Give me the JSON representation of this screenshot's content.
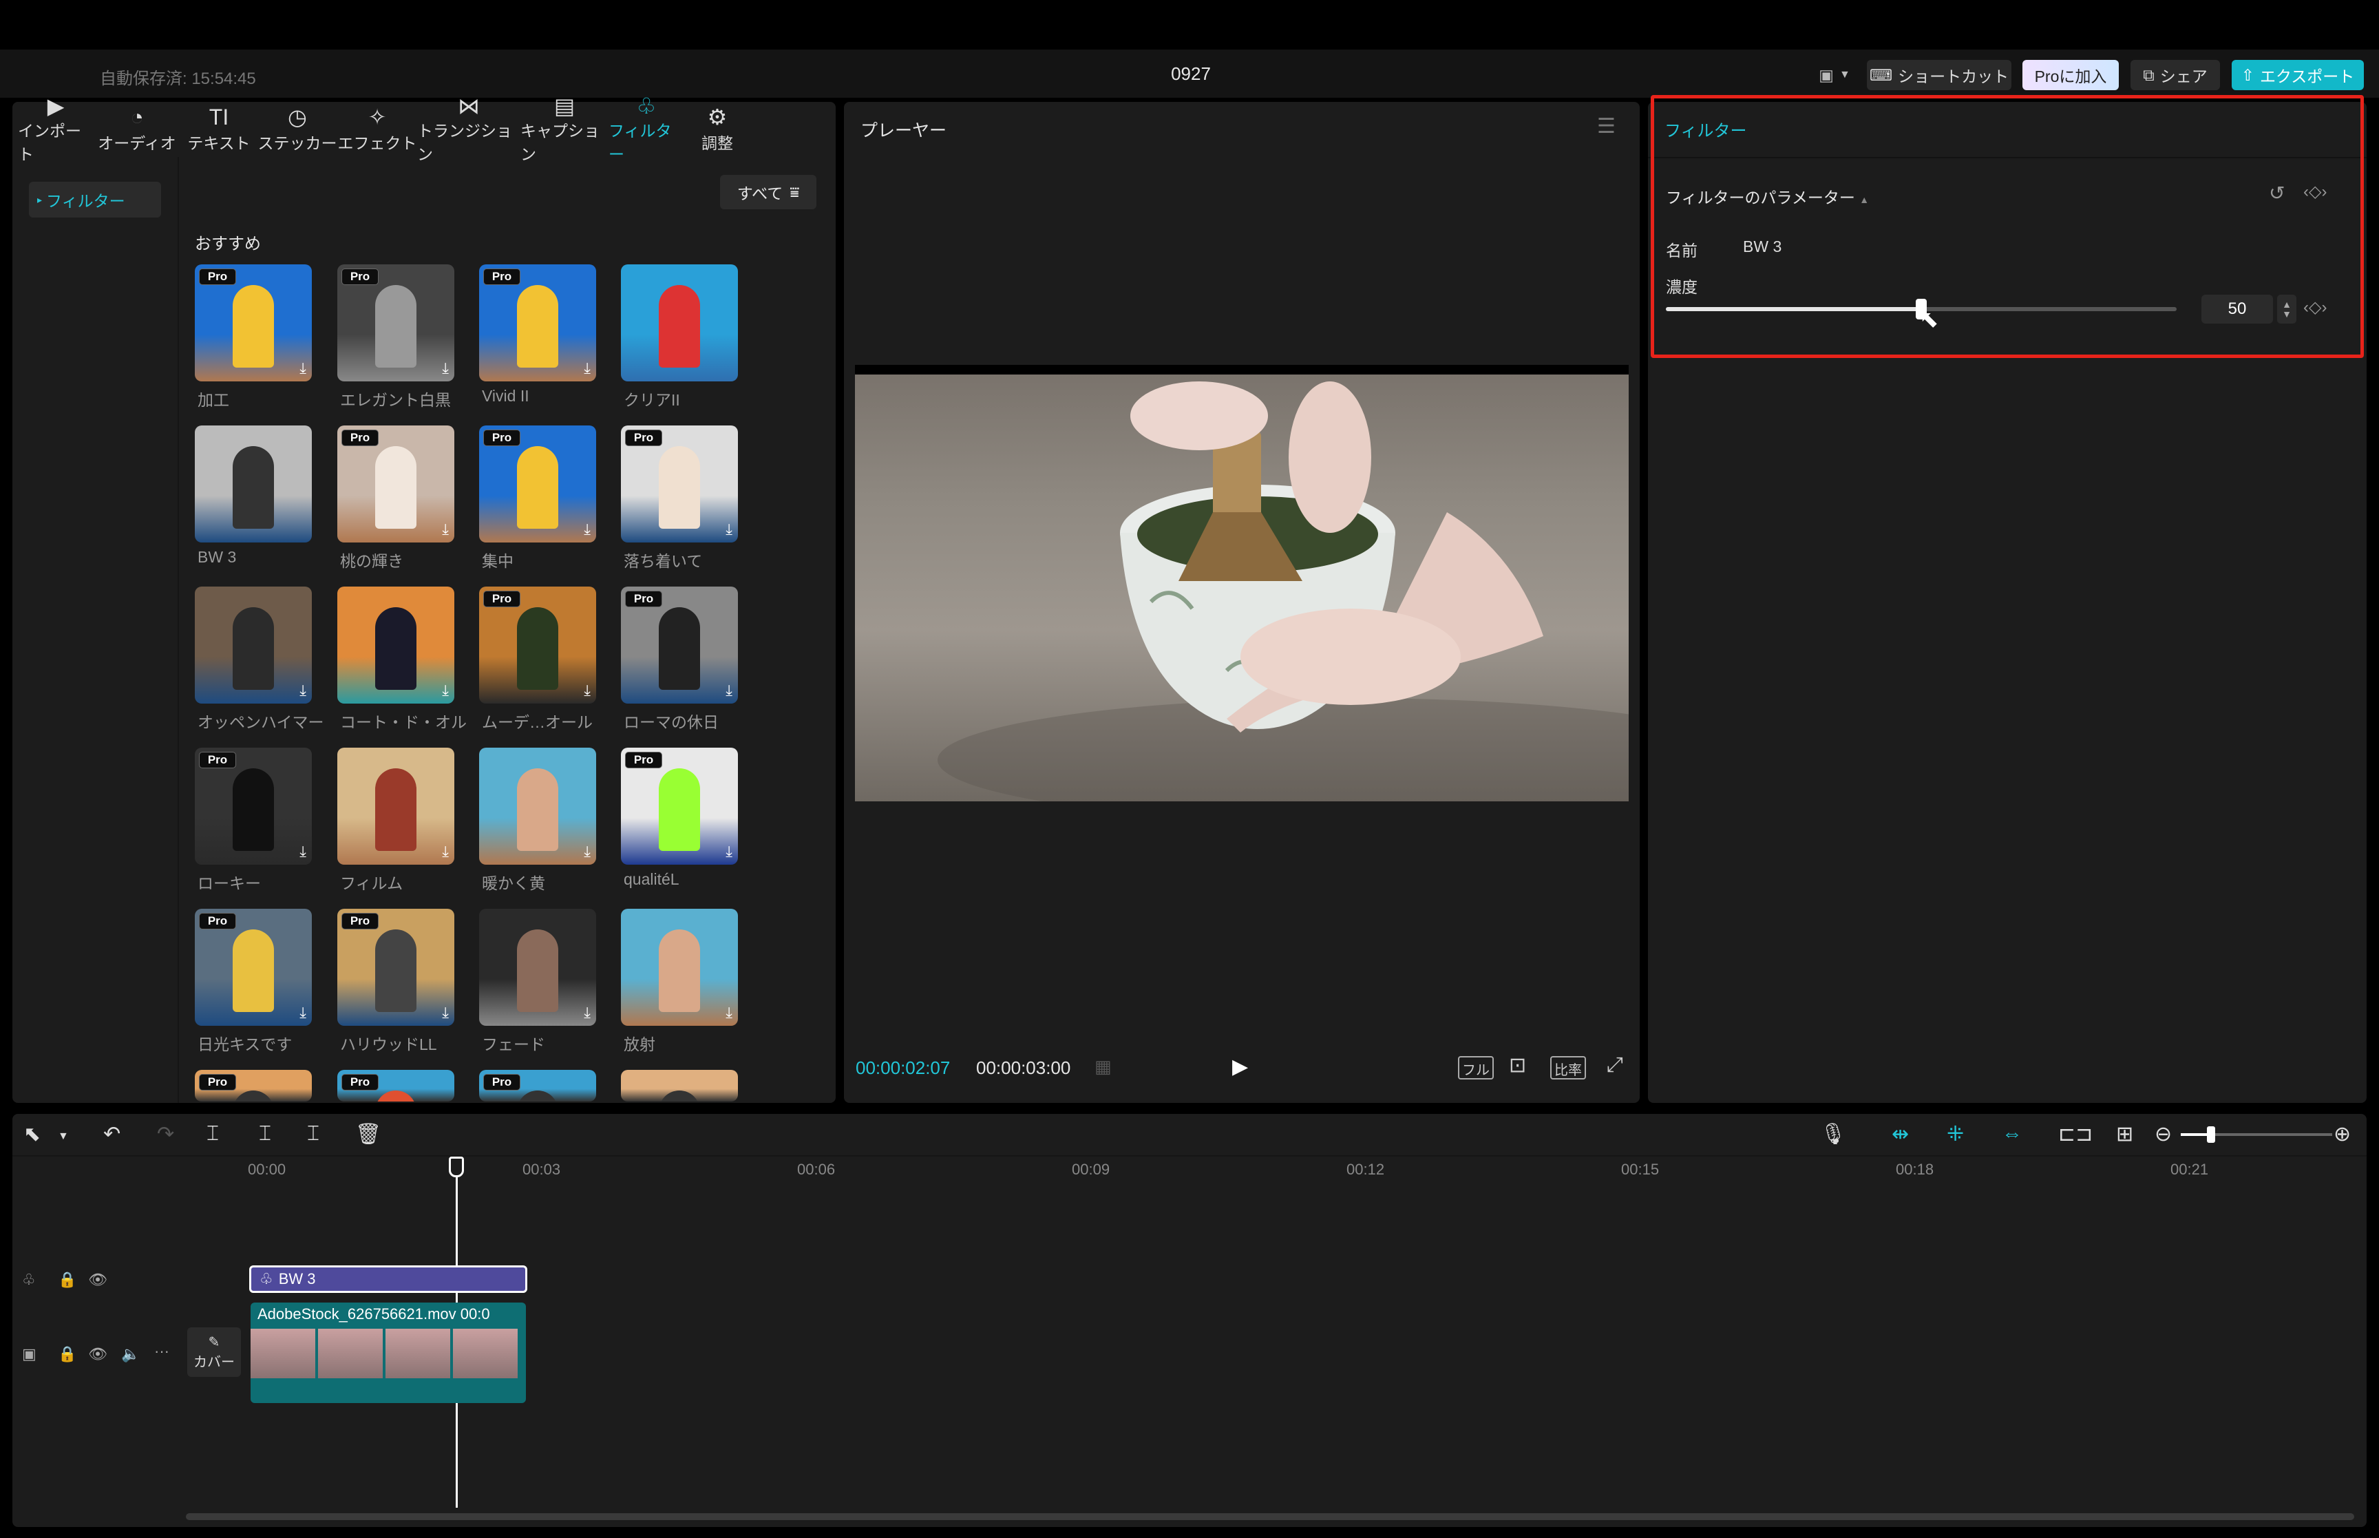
{
  "header": {
    "autosave": "自動保存済: 15:54:45",
    "project_title": "0927",
    "layout_icon": "layout-icon",
    "shortcut_label": "ショートカット",
    "pro_label": "Proに加入",
    "share_label": "シェア",
    "export_label": "エクスポート",
    "accent_color": "#12b8c9"
  },
  "tabs": [
    {
      "label": "インポート",
      "icon": "import-icon"
    },
    {
      "label": "オーディオ",
      "icon": "audio-icon"
    },
    {
      "label": "テキスト",
      "icon": "text-icon"
    },
    {
      "label": "ステッカー",
      "icon": "sticker-icon"
    },
    {
      "label": "エフェクト",
      "icon": "effect-icon"
    },
    {
      "label": "トランジション",
      "icon": "transition-icon"
    },
    {
      "label": "キャプション",
      "icon": "caption-icon"
    },
    {
      "label": "フィルター",
      "icon": "filter-icon",
      "active": true
    },
    {
      "label": "調整",
      "icon": "adjust-icon"
    }
  ],
  "sidebar": {
    "active_item": "フィルター"
  },
  "library": {
    "all_label": "すべて",
    "section_title": "おすすめ",
    "filters": [
      {
        "label": "加工",
        "pro": true
      },
      {
        "label": "エレガント白黒",
        "pro": true
      },
      {
        "label": "Vivid II",
        "pro": true
      },
      {
        "label": "クリアII",
        "pro": false
      },
      {
        "label": "BW 3",
        "pro": false
      },
      {
        "label": "桃の輝き",
        "pro": true
      },
      {
        "label": "集中",
        "pro": true
      },
      {
        "label": "落ち着いて",
        "pro": true
      },
      {
        "label": "オッペンハイマー",
        "pro": false
      },
      {
        "label": "コート・ド・オル",
        "pro": false
      },
      {
        "label": "ムーデ…オール",
        "pro": true
      },
      {
        "label": "ローマの休日",
        "pro": true
      },
      {
        "label": "ローキー",
        "pro": true
      },
      {
        "label": "フィルム",
        "pro": false
      },
      {
        "label": "暖かく黄",
        "pro": false
      },
      {
        "label": "qualitéL",
        "pro": true
      },
      {
        "label": "日光キスです",
        "pro": true
      },
      {
        "label": "ハリウッドLL",
        "pro": true
      },
      {
        "label": "フェード",
        "pro": false
      },
      {
        "label": "放射",
        "pro": false
      },
      {
        "label": "",
        "pro": true
      },
      {
        "label": "",
        "pro": true
      },
      {
        "label": "",
        "pro": true
      },
      {
        "label": "",
        "pro": false
      }
    ],
    "pro_badge": "Pro"
  },
  "player": {
    "title": "プレーヤー",
    "current_time": "00:00:02:07",
    "total_time": "00:00:03:00",
    "ctrl_full": "フル",
    "ctrl_ratio": "比率"
  },
  "inspector": {
    "tab": "フィルター",
    "section": "フィルターのパラメーター",
    "name_label": "名前",
    "name_value": "BW 3",
    "intensity_label": "濃度",
    "intensity_value": "50",
    "intensity_fraction": 0.5
  },
  "timeline": {
    "ticks": [
      "00:00",
      "00:03",
      "00:06",
      "00:09",
      "00:12",
      "00:15",
      "00:18",
      "00:21"
    ],
    "filter_clip": "BW 3",
    "video_clip": "AdobeStock_626756621.mov  00:0",
    "cover_label": "カバー"
  }
}
